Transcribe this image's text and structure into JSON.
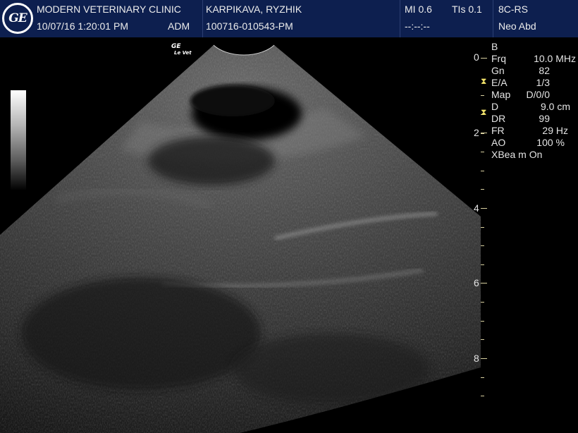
{
  "header": {
    "logo_text": "GE",
    "clinic": "MODERN VETERINARY CLINIC",
    "datetime": "10/07/16 1:20:01 PM",
    "operator": "ADM",
    "patient_name": "KARPIKAVA, RYZHIK",
    "exam_id": "100716-010543-PM",
    "mi": "MI 0.6",
    "tis": "TIs 0.1",
    "timer": "--:--:--",
    "probe": "8C-RS",
    "preset": "Neo Abd"
  },
  "brand": {
    "line1": "GE",
    "line2": "Le Vet"
  },
  "params": [
    {
      "label": "B",
      "value": ""
    },
    {
      "label": "Frq",
      "value": "10.0 MHz"
    },
    {
      "label": "Gn",
      "value": "82"
    },
    {
      "label": "E/A",
      "value": "1/3"
    },
    {
      "label": "Map",
      "value": "D/0/0"
    },
    {
      "label": "D",
      "value": "9.0 cm"
    },
    {
      "label": "DR",
      "value": "99"
    },
    {
      "label": "FR",
      "value": "29 Hz"
    },
    {
      "label": "AO",
      "value": "100 %"
    },
    {
      "label": "XBea m On",
      "value": ""
    }
  ],
  "depth_scale": {
    "labels": [
      "0",
      "2",
      "4",
      "6",
      "8"
    ]
  },
  "colors": {
    "header_bg": "#0d1f4f",
    "scale_tick": "#d8d0a0",
    "focus_marker": "#f3e36a"
  }
}
